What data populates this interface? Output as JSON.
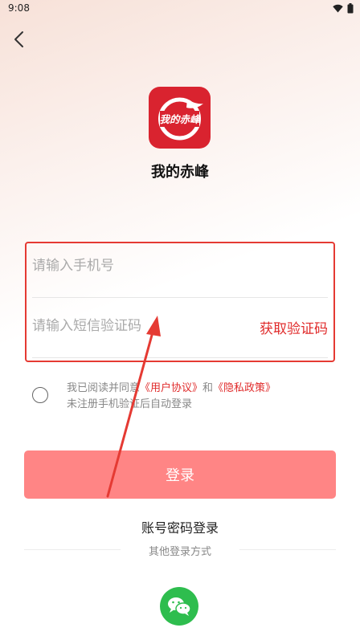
{
  "status_bar": {
    "time": "9:08"
  },
  "app": {
    "name": "我的赤峰",
    "logo_text": "我的赤峰",
    "logo_color": "#d9232f"
  },
  "form": {
    "phone_placeholder": "请输入手机号",
    "code_placeholder": "请输入短信验证码",
    "get_code_label": "获取验证码"
  },
  "agreement": {
    "prefix": "我已阅读并同意",
    "user_agreement": "《用户协议》",
    "and": "和",
    "privacy_policy": "《隐私政策》",
    "note": "未注册手机验证后自动登录"
  },
  "login_button": {
    "label": "登录",
    "color": "#ff8585"
  },
  "password_login_label": "账号密码登录",
  "other_login_label": "其他登录方式",
  "colors": {
    "accent": "#e02b2b",
    "highlight": "#e53a33",
    "wechat": "#2ebd4e"
  },
  "icons": {
    "back": "chevron-left-icon",
    "wifi": "wifi-icon",
    "battery": "battery-icon",
    "wechat": "wechat-icon"
  }
}
